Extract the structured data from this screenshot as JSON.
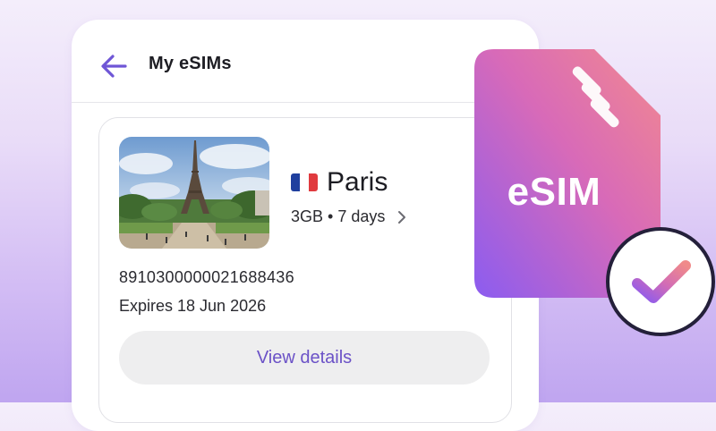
{
  "header": {
    "title": "My eSIMs"
  },
  "icons": {
    "back": "arrow-left-icon",
    "chevron": "chevron-right-icon",
    "flag": "france-flag-icon",
    "check": "check-icon"
  },
  "esim_item": {
    "city": "Paris",
    "plan": "3GB • 7 days",
    "iccid": "8910300000021688436",
    "expires": "Expires 18 Jun 2026",
    "view_label": "View details"
  },
  "badge": {
    "label": "eSIM"
  },
  "colors": {
    "accent": "#6b52c7",
    "back_arrow": "#6f56d6",
    "esim_gradient_top": "#f2898f",
    "esim_gradient_bottom": "#8b5cf0"
  }
}
